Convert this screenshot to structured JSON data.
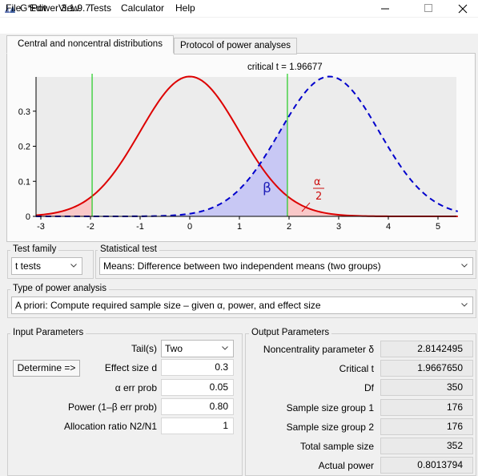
{
  "window": {
    "title": "G*Power 3.1.9.7"
  },
  "menu": [
    "File",
    "Edit",
    "View",
    "Tests",
    "Calculator",
    "Help"
  ],
  "tabs": {
    "distributions": "Central and noncentral distributions",
    "protocol": "Protocol of power analyses"
  },
  "plot": {
    "critical_label": "critical t = 1.96677",
    "beta_symbol": "β",
    "alpha_num": "α",
    "alpha_den": "2",
    "x_ticks": [
      "-3",
      "-2",
      "-1",
      "0",
      "1",
      "2",
      "3",
      "4",
      "5"
    ],
    "y_ticks": [
      "0",
      "0.1",
      "0.2",
      "0.3"
    ],
    "colors": {
      "central": "#dd0000",
      "noncentral": "#0000cc",
      "critical": "#22cc22",
      "alpha_fill": "#f9c8c8",
      "beta_fill": "#c8c8f4"
    }
  },
  "chart_data": {
    "type": "line",
    "series": [
      {
        "curve": "central t distribution",
        "df": 350,
        "center": 0
      },
      {
        "curve": "noncentral t distribution",
        "df": 350,
        "center": 2.8142495
      }
    ],
    "critical_values": [
      -1.96677,
      1.96677
    ],
    "xlim": [
      -3.1,
      5.4
    ],
    "ylim": [
      0,
      0.4
    ]
  },
  "test_family": {
    "label": "Test family",
    "value": "t tests"
  },
  "statistical_test": {
    "label": "Statistical test",
    "value": "Means: Difference between two independent means (two groups)"
  },
  "power_analysis": {
    "label": "Type of power analysis",
    "value": "A priori: Compute required sample size – given α, power, and effect size"
  },
  "input": {
    "label": "Input Parameters",
    "determine": "Determine =>",
    "tails_label": "Tail(s)",
    "tails_value": "Two",
    "effect_label": "Effect size d",
    "effect_value": "0.3",
    "alpha_label": "α err prob",
    "alpha_value": "0.05",
    "power_label": "Power (1–β err prob)",
    "power_value": "0.80",
    "ratio_label": "Allocation ratio N2/N1",
    "ratio_value": "1"
  },
  "output": {
    "label": "Output Parameters",
    "rows": [
      {
        "label": "Noncentrality parameter δ",
        "value": "2.8142495"
      },
      {
        "label": "Critical t",
        "value": "1.9667650"
      },
      {
        "label": "Df",
        "value": "350"
      },
      {
        "label": "Sample size group 1",
        "value": "176"
      },
      {
        "label": "Sample size group 2",
        "value": "176"
      },
      {
        "label": "Total sample size",
        "value": "352"
      },
      {
        "label": "Actual power",
        "value": "0.8013794"
      }
    ]
  }
}
